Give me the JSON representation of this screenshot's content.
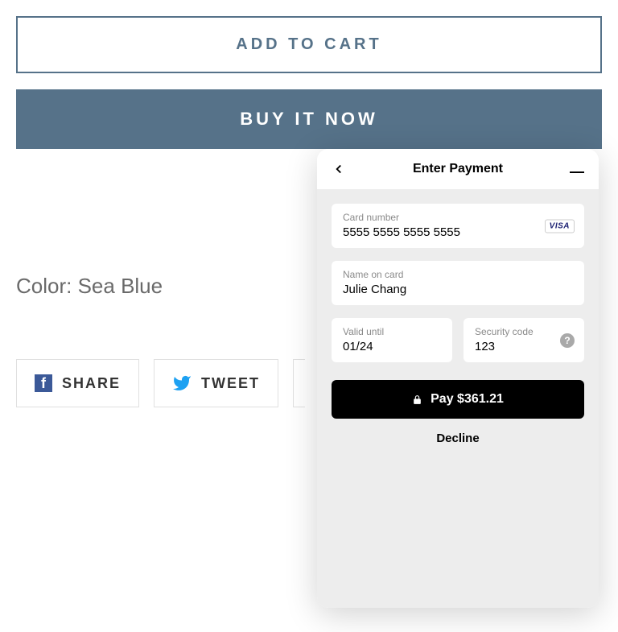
{
  "product": {
    "add_to_cart_label": "ADD TO CART",
    "buy_now_label": "BUY IT NOW",
    "color_text": "Color: Sea Blue"
  },
  "share": {
    "facebook_label": "SHARE",
    "twitter_label": "TWEET"
  },
  "payment": {
    "modal_title": "Enter Payment",
    "card_number_label": "Card number",
    "card_number_value": "5555 5555 5555 5555",
    "card_brand": "VISA",
    "name_label": "Name on card",
    "name_value": "Julie Chang",
    "valid_label": "Valid until",
    "valid_value": "01/24",
    "security_label": "Security code",
    "security_value": "123",
    "pay_button_label": "Pay $361.21",
    "decline_label": "Decline"
  }
}
